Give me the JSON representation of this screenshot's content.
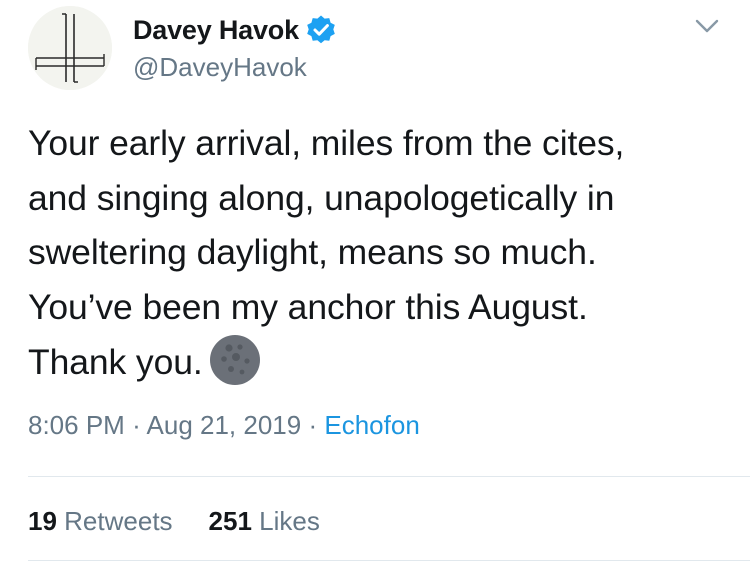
{
  "user": {
    "display_name": "Davey Havok",
    "handle": "@DaveyHavok",
    "verified": true,
    "verified_color": "#1da1f2"
  },
  "tweet": {
    "lines": [
      "Your early arrival, miles from the cites,",
      "and singing along, unapologetically in",
      "sweltering daylight, means so much.",
      "You’ve been my anchor this August.",
      "Thank you."
    ],
    "emoji": "new-moon-face-icon"
  },
  "meta": {
    "time": "8:06 PM",
    "separator": "·",
    "date": "Aug 21, 2019",
    "source": "Echofon"
  },
  "stats": {
    "retweets_count": "19",
    "retweets_label": "Retweets",
    "likes_count": "251",
    "likes_label": "Likes"
  },
  "colors": {
    "text": "#14171a",
    "secondary": "#657786",
    "link": "#1b95e0",
    "divider": "#e1e8ed"
  }
}
